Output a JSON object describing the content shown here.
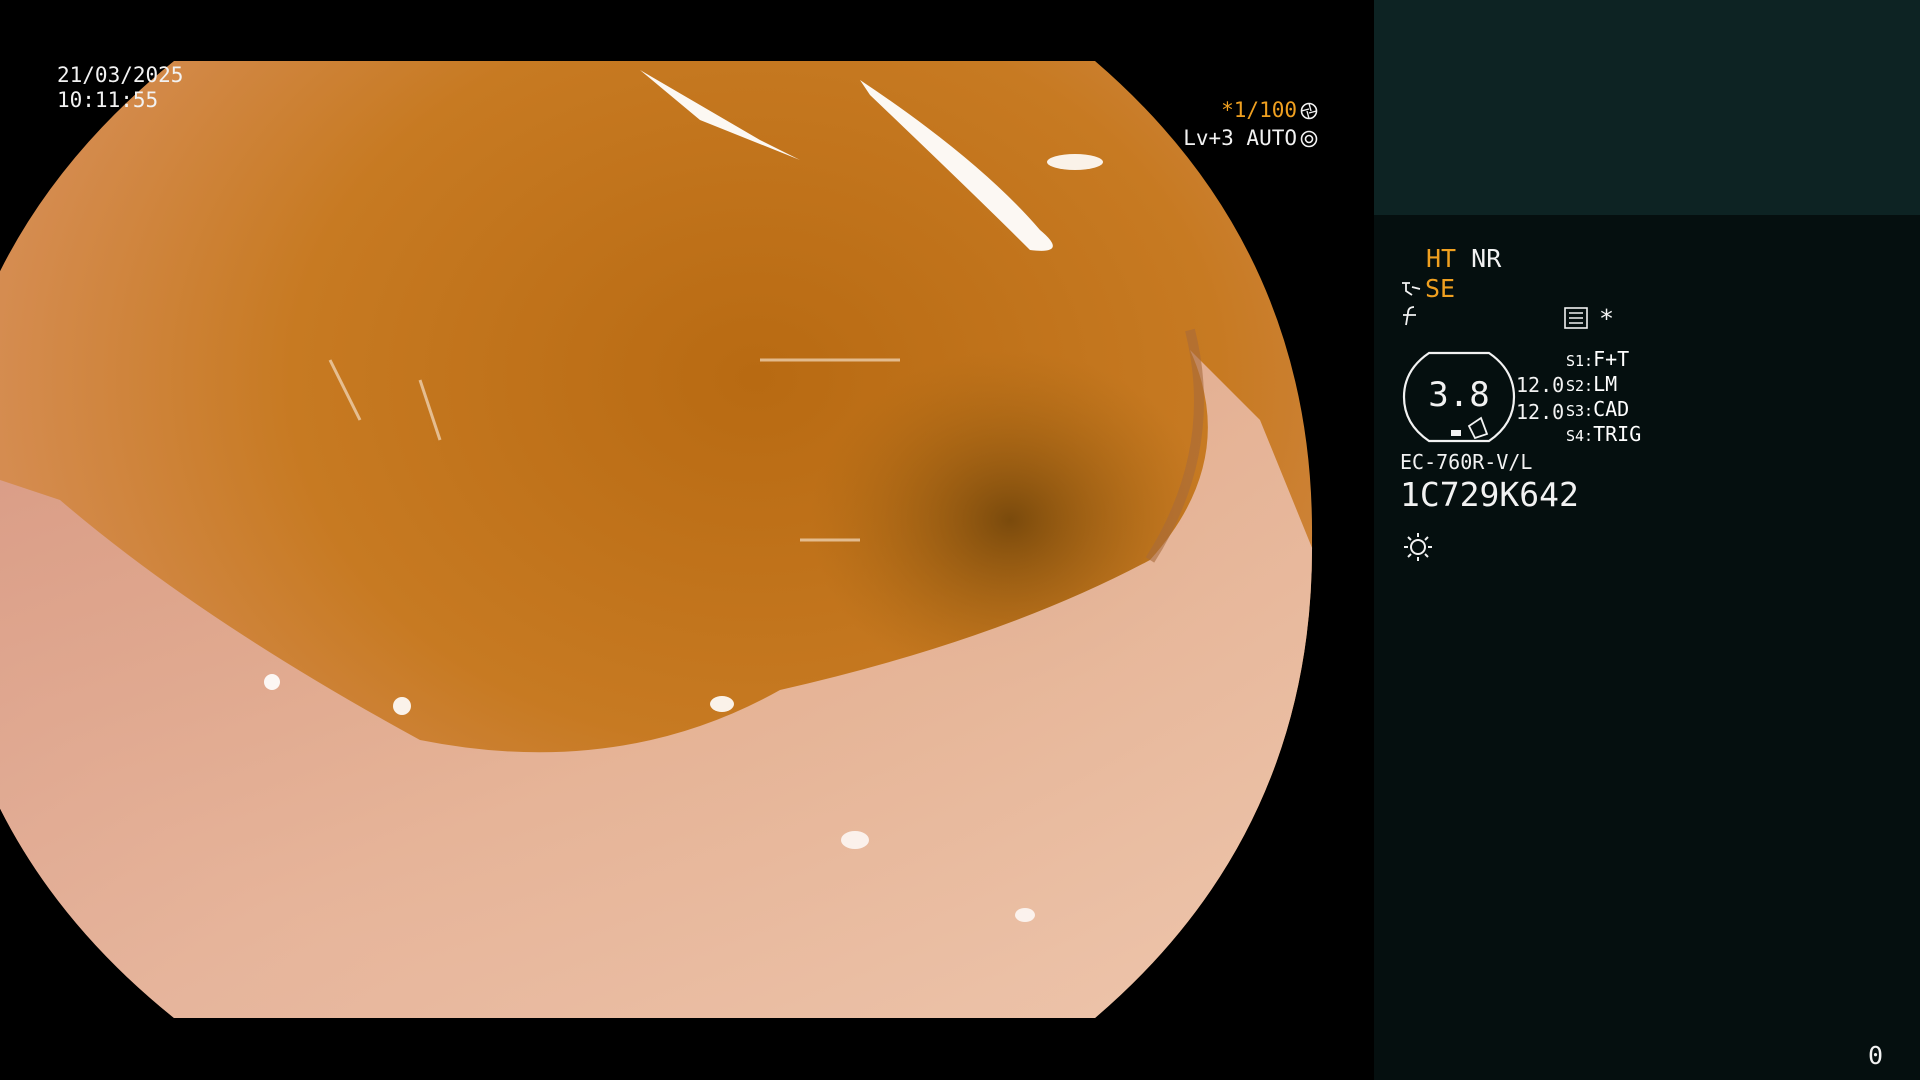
{
  "overlay": {
    "date": "21/03/2025",
    "time": "10:11:55",
    "shutter_prefix": "*",
    "shutter_value": "1/100",
    "shutter_icon": "aperture-icon",
    "level": "Lv+3",
    "exposure_mode": "AUTO",
    "exposure_icon": "iris-icon"
  },
  "panel": {
    "ht": "HT",
    "nr": "NR",
    "se": "SE",
    "se_icon": "mode-icon",
    "f_icon": "f-icon",
    "menu_icon": "menu-icon",
    "asterisk": "*",
    "gauge_value": "3.8",
    "gauge_icon": "gauge-icon",
    "value_a": "12.0",
    "value_b": "12.0",
    "switches": [
      {
        "key": "S1:",
        "label": "F+T"
      },
      {
        "key": "S2:",
        "label": "LM"
      },
      {
        "key": "S3:",
        "label": "CAD"
      },
      {
        "key": "S4:",
        "label": "TRIG"
      }
    ],
    "scope_model": "EC-760R-V/L",
    "scope_serial": "1C729K642",
    "light_icon": "light-icon",
    "counter": "0"
  },
  "colors": {
    "accent": "#f0a020",
    "panel_bg": "#050f0f",
    "panel_top_bg": "#0d2323",
    "text": "#f2f2f2"
  }
}
